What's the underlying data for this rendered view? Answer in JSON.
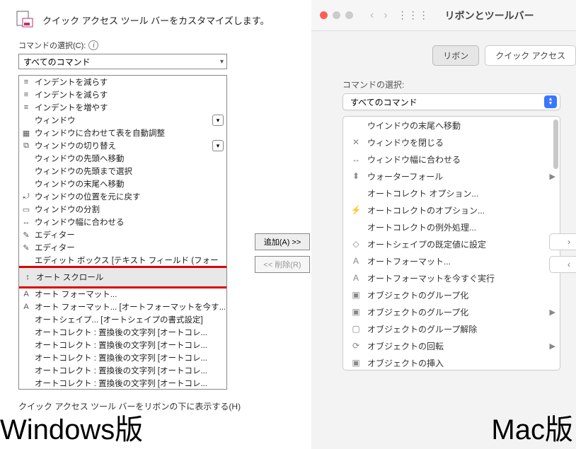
{
  "windows": {
    "header_title": "クイック アクセス ツール バーをカスタマイズします。",
    "command_select_label": "コマンドの選択(C):",
    "command_select_value": "すべてのコマンド",
    "add_button": "追加(A) >>",
    "remove_button": "<< 削除(R)",
    "footer_partial": "クイック アクセス ツール バーをリボンの下に表示する(H)",
    "caption": "Windows版",
    "items": [
      {
        "label": "インデントを減らす",
        "icon": "indent-decrease",
        "submenu": false
      },
      {
        "label": "インデントを減らす",
        "icon": "indent-decrease",
        "submenu": false
      },
      {
        "label": "インデントを増やす",
        "icon": "indent-increase",
        "submenu": false
      },
      {
        "label": "ウィンドウ",
        "icon": "",
        "submenu": true
      },
      {
        "label": "ウィンドウに合わせて表を自動調整",
        "icon": "table-fit",
        "submenu": false
      },
      {
        "label": "ウィンドウの切り替え",
        "icon": "window-switch",
        "submenu": true
      },
      {
        "label": "ウィンドウの先頭へ移動",
        "icon": "",
        "submenu": false
      },
      {
        "label": "ウィンドウの先頭まで選択",
        "icon": "",
        "submenu": false
      },
      {
        "label": "ウィンドウの末尾へ移動",
        "icon": "",
        "submenu": false
      },
      {
        "label": "ウィンドウの位置を元に戻す",
        "icon": "window-reset",
        "submenu": false
      },
      {
        "label": "ウィンドウの分割",
        "icon": "window-split",
        "submenu": false
      },
      {
        "label": "ウィンドウ幅に合わせる",
        "icon": "window-fit-width",
        "submenu": false
      },
      {
        "label": "エディター",
        "icon": "editor",
        "submenu": false
      },
      {
        "label": "エディター",
        "icon": "editor",
        "submenu": false
      },
      {
        "label": "エディット ボックス [テキスト フィールド (フォー",
        "icon": "",
        "submenu": false
      },
      {
        "label": "オート スクロール",
        "icon": "auto-scroll",
        "submenu": false,
        "selected": true
      },
      {
        "label": "オート フォーマット...",
        "icon": "auto-format",
        "submenu": false
      },
      {
        "label": "オート フォーマット... [オートフォーマットを今す...",
        "icon": "auto-format-now",
        "submenu": false
      },
      {
        "label": "オートシェイプ... [オートシェイプの書式設定]",
        "icon": "",
        "submenu": false
      },
      {
        "label": "オートコレクト : 置換後の文字列 [オートコレ...",
        "icon": "",
        "submenu": false
      },
      {
        "label": "オートコレクト : 置換後の文字列 [オートコレ...",
        "icon": "",
        "submenu": false
      },
      {
        "label": "オートコレクト : 置換後の文字列 [オートコレ...",
        "icon": "",
        "submenu": false
      },
      {
        "label": "オートコレクト : 置換後の文字列 [オートコレ...",
        "icon": "",
        "submenu": false
      },
      {
        "label": "オートコレクト : 置換後の文字列 [オートコレ...",
        "icon": "",
        "submenu": false
      },
      {
        "label": "オートコレクト : 置換後の文字列 [オートコレ...",
        "icon": "",
        "submenu": false
      }
    ]
  },
  "mac": {
    "window_title": "リボンとツールバー",
    "tab_ribbon": "リボン",
    "tab_qat": "クイック アクセス",
    "section_label": "コマンドの選択:",
    "dropdown_value": "すべてのコマンド",
    "caption": "Mac版",
    "items": [
      {
        "label": "ウインドウの末尾へ移動",
        "icon": "",
        "submenu": false
      },
      {
        "label": "ウィンドウを閉じる",
        "icon": "close",
        "submenu": false
      },
      {
        "label": "ウィンドウ幅に合わせる",
        "icon": "fit-width",
        "submenu": false
      },
      {
        "label": "ウォーターフォール",
        "icon": "waterfall",
        "submenu": true
      },
      {
        "label": "オートコレクト オプション...",
        "icon": "",
        "submenu": false
      },
      {
        "label": "オートコレクトのオプション...",
        "icon": "autocorrect",
        "submenu": false
      },
      {
        "label": "オートコレクトの例外処理...",
        "icon": "",
        "submenu": false
      },
      {
        "label": "オートシェイプの既定値に設定",
        "icon": "autoshape-default",
        "submenu": false
      },
      {
        "label": "オートフォーマット...",
        "icon": "autoformat",
        "submenu": false
      },
      {
        "label": "オートフォーマットを今すぐ実行",
        "icon": "autoformat-now",
        "submenu": false
      },
      {
        "label": "オブジェクトのグループ化",
        "icon": "group",
        "submenu": false
      },
      {
        "label": "オブジェクトのグループ化",
        "icon": "group",
        "submenu": true
      },
      {
        "label": "オブジェクトのグループ解除",
        "icon": "ungroup",
        "submenu": false
      },
      {
        "label": "オブジェクトの回転",
        "icon": "rotate",
        "submenu": true
      },
      {
        "label": "オブジェクトの挿入",
        "icon": "insert-object",
        "submenu": false
      }
    ]
  }
}
